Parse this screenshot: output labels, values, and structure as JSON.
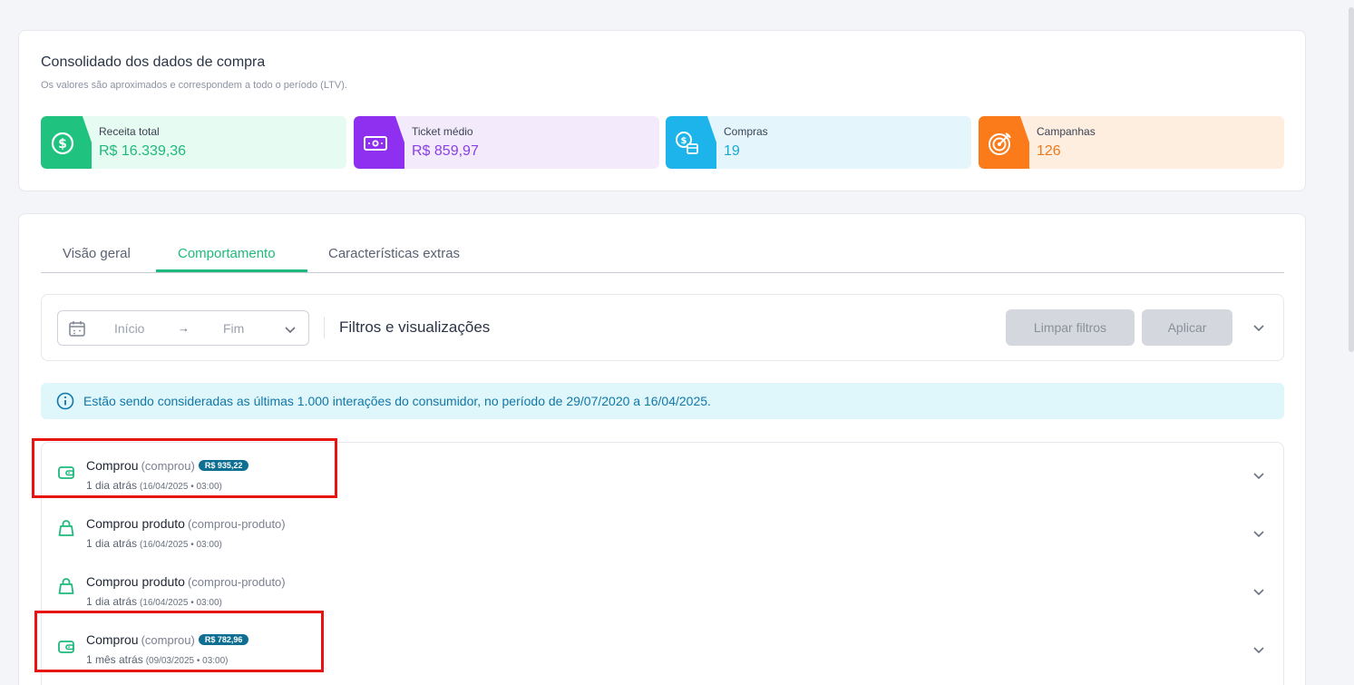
{
  "summary": {
    "title": "Consolidado dos dados de compra",
    "subtitle": "Os valores são aproximados e correspondem a todo o período (LTV).",
    "stats": [
      {
        "label": "Receita total",
        "value": "R$ 16.339,36",
        "icon": "dollar-circle-icon",
        "accent": "#1fc27f",
        "bg": "#e6fbf1",
        "value_color": "#1fb97d"
      },
      {
        "label": "Ticket médio",
        "value": "R$ 859,97",
        "icon": "money-bill-icon",
        "accent": "#8f2ff0",
        "bg": "#f3ebfc",
        "value_color": "#8a3fe6"
      },
      {
        "label": "Compras",
        "value": "19",
        "icon": "dollar-calendar-icon",
        "accent": "#1cb4ea",
        "bg": "#e4f6fc",
        "value_color": "#18a9dc"
      },
      {
        "label": "Campanhas",
        "value": "126",
        "icon": "target-icon",
        "accent": "#fb7a1a",
        "bg": "#fdeee0",
        "value_color": "#ec7a1c"
      }
    ]
  },
  "tabs": [
    {
      "label": "Visão geral",
      "active": false
    },
    {
      "label": "Comportamento",
      "active": true
    },
    {
      "label": "Características extras",
      "active": false
    }
  ],
  "filters": {
    "start_placeholder": "Início",
    "arrow": "→",
    "end_placeholder": "Fim",
    "title": "Filtros e visualizações",
    "clear_label": "Limpar filtros",
    "apply_label": "Aplicar"
  },
  "info_banner": "Estão sendo consideradas as últimas 1.000 interações do consumidor, no período de 29/07/2020 a 16/04/2025.",
  "events": [
    {
      "title": "Comprou",
      "slug": "(comprou)",
      "badge": "R$ 935,22",
      "relative": "1 dia atrás",
      "date": "(16/04/2025 • 03:00)",
      "icon": "wallet-icon",
      "highlighted": true
    },
    {
      "title": "Comprou produto",
      "slug": "(comprou-produto)",
      "badge": "",
      "relative": "1 dia atrás",
      "date": "(16/04/2025 • 03:00)",
      "icon": "shopping-bag-icon",
      "highlighted": false
    },
    {
      "title": "Comprou produto",
      "slug": "(comprou-produto)",
      "badge": "",
      "relative": "1 dia atrás",
      "date": "(16/04/2025 • 03:00)",
      "icon": "shopping-bag-icon",
      "highlighted": false
    },
    {
      "title": "Comprou",
      "slug": "(comprou)",
      "badge": "R$ 782,96",
      "relative": "1 mês atrás",
      "date": "(09/03/2025 • 03:00)",
      "icon": "wallet-icon",
      "highlighted": true
    }
  ],
  "colors": {
    "brand_green": "#1fb97d",
    "highlight_red": "#e8140f",
    "badge_blue": "#0f6f93"
  }
}
